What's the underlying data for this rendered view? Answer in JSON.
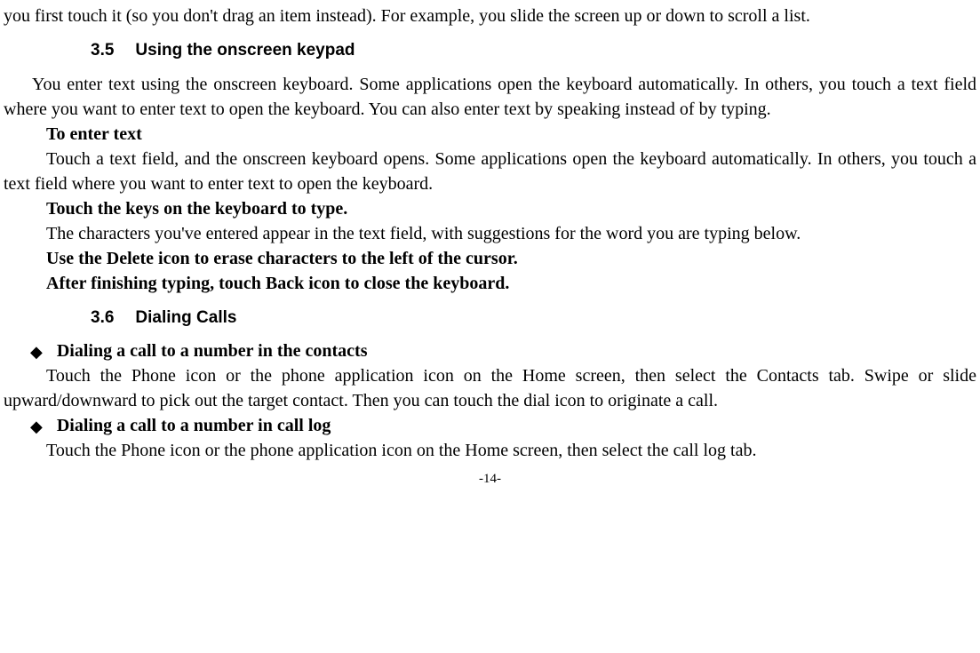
{
  "intro_fragment": "you first touch it (so you don't drag an item instead). For example, you slide the screen up or down to scroll a list.",
  "section_3_5": {
    "num": "3.5",
    "title": "Using the onscreen keypad",
    "p1": "You enter text using the onscreen keyboard. Some applications open the keyboard automatically. In others, you touch a text field where you want to enter text to open the keyboard. You can also enter text by speaking instead of by typing.",
    "h_enter": "To enter text",
    "p_enter": "Touch a text field, and the onscreen keyboard opens. Some applications open the keyboard automatically. In others, you touch a text field where you want to enter text to open the keyboard.",
    "h_touch": "Touch the keys on the keyboard to type.",
    "p_touch": "The characters you've entered appear in the text field, with suggestions for the word you are typing below.",
    "h_delete": "Use the Delete icon to erase characters to the left of the cursor.",
    "h_after": "After finishing typing, touch Back icon to close the keyboard."
  },
  "section_3_6": {
    "num": "3.6",
    "title": "Dialing Calls",
    "b1_label": "Dialing a call to a number in the contacts",
    "b1_text": "Touch the Phone icon or the phone application icon on the Home screen, then select the Contacts tab. Swipe or slide upward/downward to pick out the target contact. Then you can touch the dial icon to originate a call.",
    "b2_label": "Dialing a call to a number in call log",
    "b2_text": "Touch the Phone icon or the phone application icon on the Home screen, then select the call log tab."
  },
  "page_number": "-14-"
}
